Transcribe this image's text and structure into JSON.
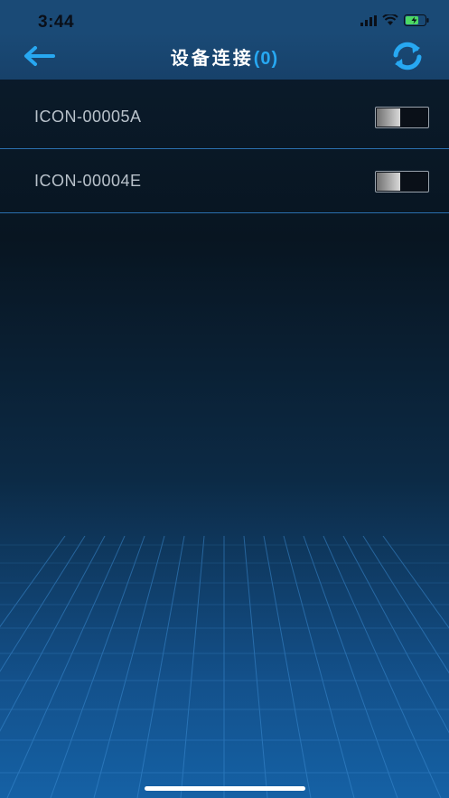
{
  "status_bar": {
    "time": "3:44",
    "icons": [
      "signal-icon",
      "wifi-icon",
      "battery-charging-icon"
    ]
  },
  "header": {
    "title": "设备连接",
    "count": "(0)",
    "back_icon": "arrow-left-icon",
    "refresh_icon": "refresh-icon"
  },
  "devices": [
    {
      "name": "ICON-00005A",
      "connected": false
    },
    {
      "name": "ICON-00004E",
      "connected": false
    }
  ],
  "colors": {
    "accent": "#27a8f2",
    "header_bg": "#1a4a76",
    "divider": "#2a6fae",
    "battery": "#4cd964"
  }
}
